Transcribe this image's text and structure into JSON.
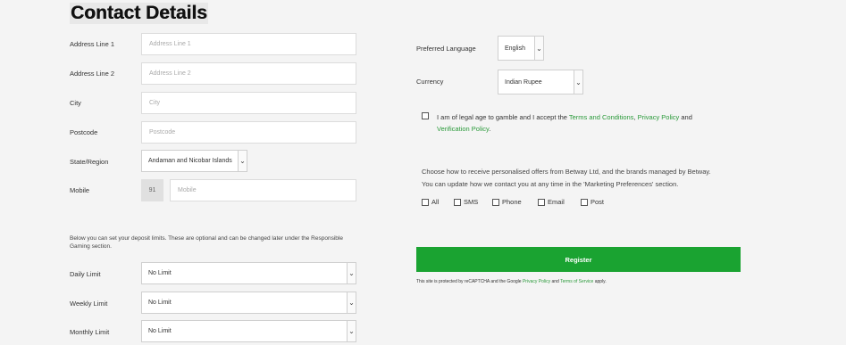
{
  "page": {
    "title": "Contact Details"
  },
  "address": {
    "line1_label": "Address Line 1",
    "line1_placeholder": "Address Line 1",
    "line2_label": "Address Line 2",
    "line2_placeholder": "Address Line 2",
    "city_label": "City",
    "city_placeholder": "City",
    "postcode_label": "Postcode",
    "postcode_placeholder": "Postcode",
    "region_label": "State/Region",
    "region_value": "Andaman and Nicobar Islands",
    "mobile_label": "Mobile",
    "mobile_prefix": "91",
    "mobile_placeholder": "Mobile"
  },
  "limits": {
    "note": "Below you can set your deposit limits. These are optional and can be changed later under the Responsible Gaming section.",
    "daily_label": "Daily Limit",
    "daily_value": "No Limit",
    "weekly_label": "Weekly Limit",
    "weekly_value": "No Limit",
    "monthly_label": "Monthly Limit",
    "monthly_value": "No Limit"
  },
  "preferences": {
    "language_label": "Preferred Language",
    "language_value": "English",
    "currency_label": "Currency",
    "currency_value": "Indian Rupee"
  },
  "terms": {
    "text_before": "I am of legal age to gamble and I accept the ",
    "link_terms": "Terms and Conditions",
    "sep": ", ",
    "link_privacy": "Privacy Policy",
    "and": " and",
    "link_verification": "Verification Policy",
    "end": "."
  },
  "marketing": {
    "line1": "Choose how to receive personalised offers from Betway Ltd, and the brands managed by Betway.",
    "line2": "You can update how we contact you at any time in the 'Marketing Preferences' section.",
    "options": [
      "All",
      "SMS",
      "Phone",
      "Email",
      "Post"
    ]
  },
  "register": {
    "label": "Register",
    "recaptcha_before": "This site is protected by reCAPTCHA and the Google ",
    "recaptcha_privacy": "Privacy Policy",
    "recaptcha_and": " and ",
    "recaptcha_terms": "Terms of Service",
    "recaptcha_after": " apply."
  },
  "colors": {
    "accent": "#1aa331",
    "link": "#2a9a3a",
    "background": "#f4f4f4"
  },
  "icons": {
    "select_caret": "chevron-down-icon"
  }
}
